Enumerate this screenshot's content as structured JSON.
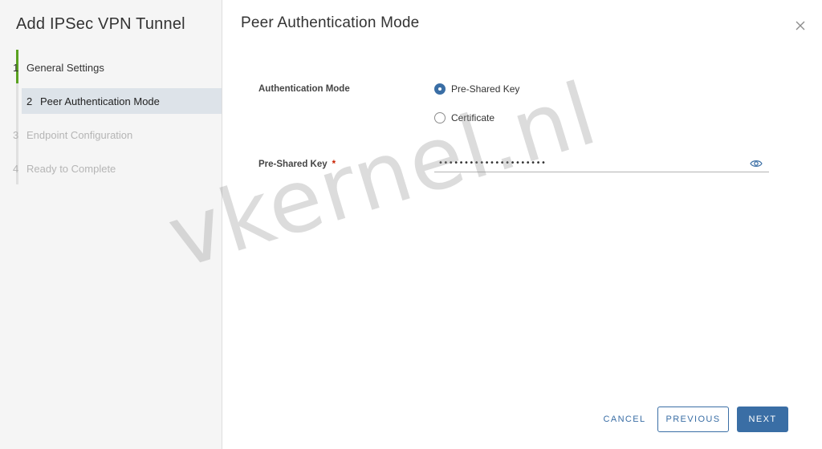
{
  "wizard": {
    "title": "Add IPSec VPN Tunnel",
    "steps": [
      {
        "number": "1",
        "label": "General Settings",
        "state": "completed"
      },
      {
        "number": "2",
        "label": "Peer Authentication Mode",
        "state": "current"
      },
      {
        "number": "3",
        "label": "Endpoint Configuration",
        "state": "disabled"
      },
      {
        "number": "4",
        "label": "Ready to Complete",
        "state": "disabled"
      }
    ]
  },
  "page": {
    "title": "Peer Authentication Mode"
  },
  "form": {
    "auth_mode_label": "Authentication Mode",
    "auth_options": [
      {
        "label": "Pre-Shared Key",
        "selected": true
      },
      {
        "label": "Certificate",
        "selected": false
      }
    ],
    "psk_label": "Pre-Shared Key",
    "psk_required_marker": "*",
    "psk_value_masked": "•••••••••••••••••••••"
  },
  "footer": {
    "cancel_label": "CANCEL",
    "previous_label": "PREVIOUS",
    "next_label": "NEXT"
  },
  "icons": {
    "close": "close-icon",
    "reveal_password": "eye-icon"
  },
  "colors": {
    "accent": "#3a6ea5",
    "completed_step": "#5aa220",
    "required": "#c92100",
    "current_step_bg": "#dde3e9"
  },
  "watermark": "vkernel.nl"
}
